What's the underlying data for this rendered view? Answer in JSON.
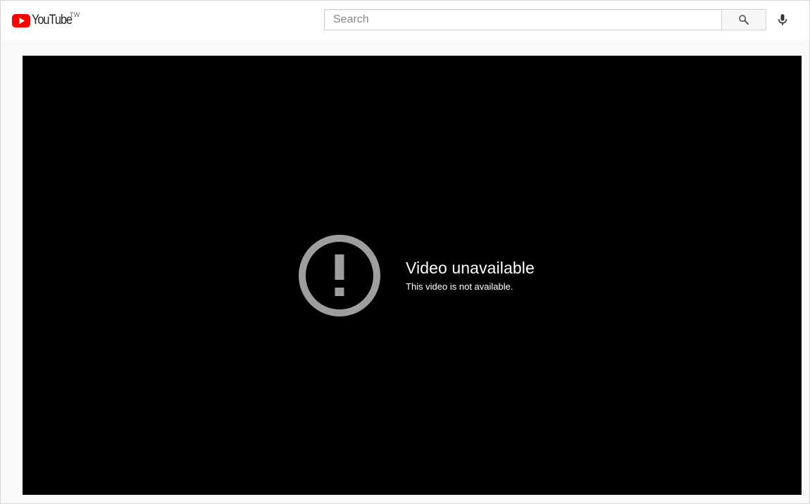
{
  "masthead": {
    "logo_text": "YouTube",
    "country_code": "TW",
    "brand_color": "#ff0000",
    "search": {
      "placeholder": "Search",
      "value": "",
      "button_icon": "search-icon"
    },
    "voice_search_icon": "microphone-icon"
  },
  "player": {
    "background_color": "#000000",
    "error": {
      "icon": "alert-circle-icon",
      "icon_color": "#9e9e9e",
      "title": "Video unavailable",
      "subtitle": "This video is not available."
    }
  }
}
